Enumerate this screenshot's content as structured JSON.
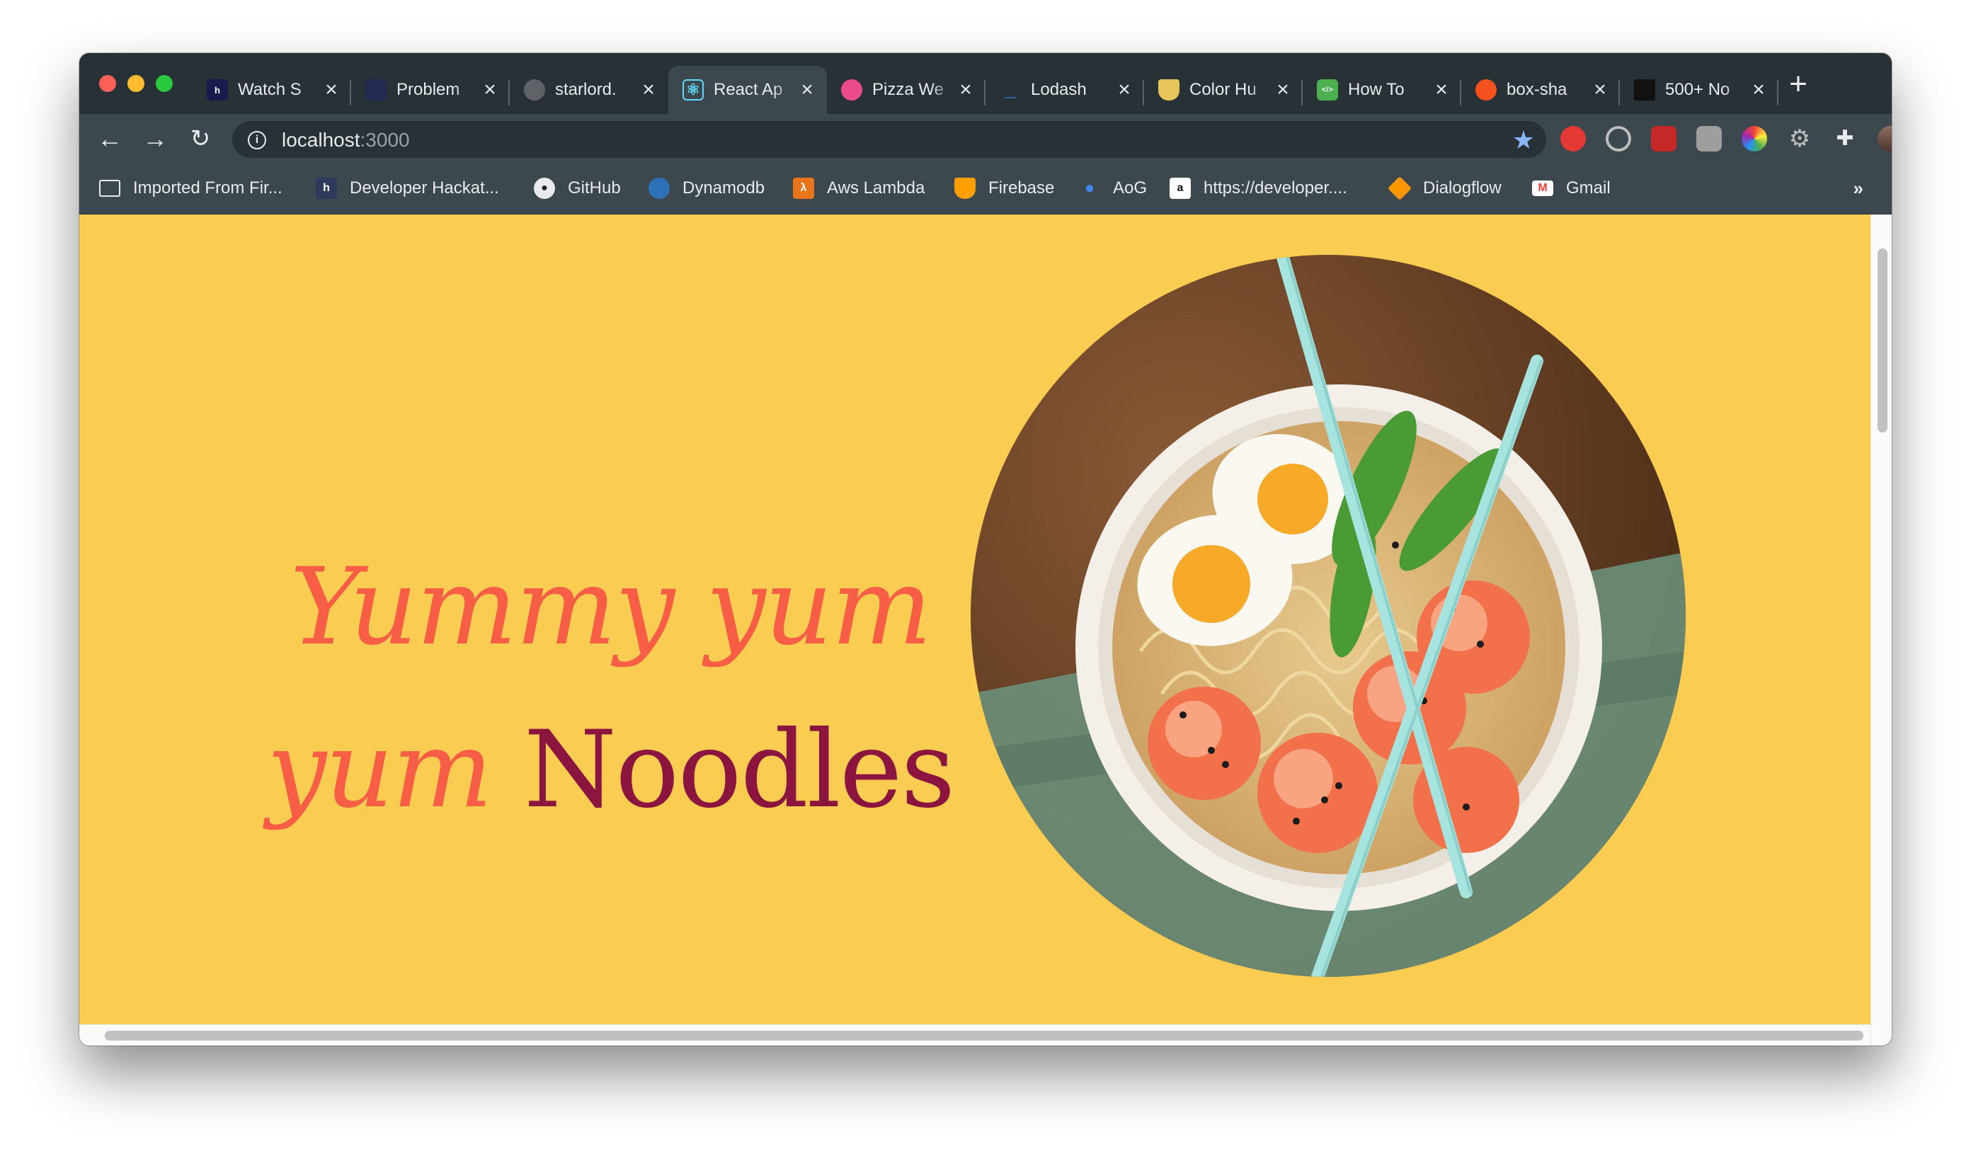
{
  "browser": {
    "tabs": [
      {
        "title": "Watch S",
        "icon": "hotstar-icon",
        "icon_text": "h",
        "icon_color": "#1a1a4d"
      },
      {
        "title": "Problem",
        "icon": "problem-icon",
        "icon_text": "",
        "icon_color": "#232a52"
      },
      {
        "title": "starlord.",
        "icon": "globe-icon",
        "icon_text": "",
        "icon_color": "#5f6368"
      },
      {
        "title": "React Ap",
        "icon": "react-icon",
        "icon_text": "⚛",
        "icon_color": "#61dafb",
        "active": true
      },
      {
        "title": "Pizza We",
        "icon": "dribbble-icon",
        "icon_text": "",
        "icon_color": "#ea4c89"
      },
      {
        "title": "Lodash",
        "icon": "lodash-icon",
        "icon_text": "_",
        "icon_color": "#3492ff"
      },
      {
        "title": "Color Hu",
        "icon": "colorhunt-icon",
        "icon_text": "",
        "icon_color": "#e8c55b"
      },
      {
        "title": "How To",
        "icon": "howto-icon",
        "icon_text": "</>",
        "icon_color": "#4caf50"
      },
      {
        "title": "box-sha",
        "icon": "boxshadow-icon",
        "icon_text": "",
        "icon_color": "#f4511e"
      },
      {
        "title": "500+ No",
        "icon": "unsplash-icon",
        "icon_text": "",
        "icon_color": "#111111"
      }
    ],
    "url_host": "localhost",
    "url_port": ":3000",
    "bookmarks": [
      {
        "label": "Imported From Fir...",
        "icon": "folder-icon",
        "icon_color": "transparent"
      },
      {
        "label": "Developer Hackat...",
        "icon": "hackathon-icon",
        "icon_color": "#2e3a5c"
      },
      {
        "label": "GitHub",
        "icon": "github-icon",
        "icon_color": "#1b1f23"
      },
      {
        "label": "Dynamodb",
        "icon": "dynamodb-icon",
        "icon_color": "#2d72b8"
      },
      {
        "label": "Aws Lambda",
        "icon": "lambda-icon",
        "icon_color": "#e8751a"
      },
      {
        "label": "Firebase",
        "icon": "firebase-icon",
        "icon_color": "#ffa000"
      },
      {
        "label": "AoG",
        "icon": "assistant-icon",
        "icon_color": "#4285f4"
      },
      {
        "label": "https://developer....",
        "icon": "amazon-icon",
        "icon_color": "#ffffff"
      },
      {
        "label": "Dialogflow",
        "icon": "dialogflow-icon",
        "icon_color": "#ff9800"
      },
      {
        "label": "Gmail",
        "icon": "gmail-icon",
        "icon_color": "#ea4335"
      }
    ],
    "bookmarks_more": "»"
  },
  "page": {
    "background": "#fbcc52",
    "headline_part1": "Yummy yum",
    "headline_part2": "yum",
    "headline_part3": "Noodles",
    "headline_color": "#f75e45",
    "accent_color": "#8c1540"
  }
}
